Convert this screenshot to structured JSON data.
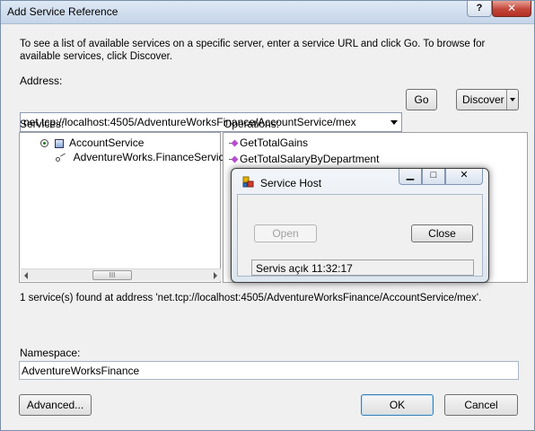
{
  "window": {
    "title": "Add Service Reference",
    "help_glyph": "?",
    "close_glyph": "✕"
  },
  "instruction": "To see a list of available services on a specific server, enter a service URL and click Go. To browse for available services, click Discover.",
  "address": {
    "label": "Address:",
    "value": "net.tcp://localhost:4505/AdventureWorksFinance/AccountService/mex"
  },
  "buttons": {
    "go": "Go",
    "discover": "Discover",
    "advanced": "Advanced...",
    "ok": "OK",
    "cancel": "Cancel"
  },
  "services": {
    "label": "Services:",
    "items": [
      "AccountService",
      "AdventureWorks.FinanceService"
    ],
    "scroll_thumb": "III"
  },
  "operations": {
    "label": "Operations:",
    "items": [
      "GetTotalGains",
      "GetTotalSalaryByDepartment"
    ]
  },
  "status": "1 service(s) found at address 'net.tcp://localhost:4505/AdventureWorksFinance/AccountService/mex'.",
  "namespace": {
    "label": "Namespace:",
    "value": "AdventureWorksFinance"
  },
  "service_host": {
    "title": "Service Host",
    "minimize_glyph": "▁",
    "maximize_glyph": "□",
    "close_glyph": "✕",
    "open_label": "Open",
    "close_label": "Close",
    "status_text": "Servis açık 11:32:17"
  }
}
